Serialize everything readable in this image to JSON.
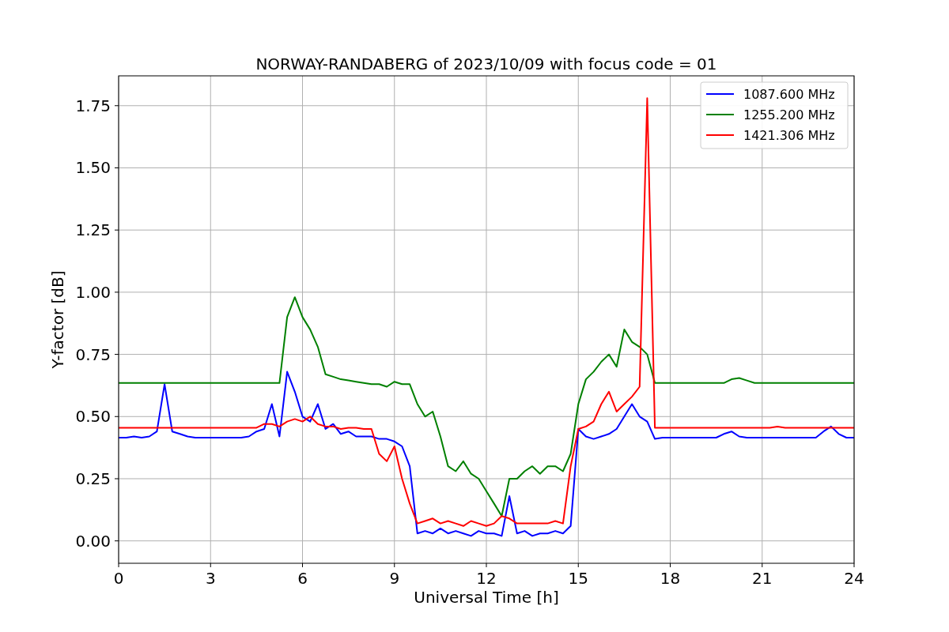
{
  "chart_data": {
    "type": "line",
    "title": "NORWAY-RANDABERG of 2023/10/09 with focus code = 01",
    "xlabel": "Universal Time [h]",
    "ylabel": "Y-factor [dB]",
    "x": [
      0,
      0.25,
      0.5,
      0.75,
      1,
      1.25,
      1.5,
      1.75,
      2,
      2.25,
      2.5,
      2.75,
      3,
      3.25,
      3.5,
      3.75,
      4,
      4.25,
      4.5,
      4.75,
      5,
      5.25,
      5.5,
      5.75,
      6,
      6.25,
      6.5,
      6.75,
      7,
      7.25,
      7.5,
      7.75,
      8,
      8.25,
      8.5,
      8.75,
      9,
      9.25,
      9.5,
      9.75,
      10,
      10.25,
      10.5,
      10.75,
      11,
      11.25,
      11.5,
      11.75,
      12,
      12.25,
      12.5,
      12.75,
      13,
      13.25,
      13.5,
      13.75,
      14,
      14.25,
      14.5,
      14.75,
      15,
      15.25,
      15.5,
      15.75,
      16,
      16.25,
      16.5,
      16.75,
      17,
      17.25,
      17.5,
      17.75,
      18,
      18.25,
      18.5,
      18.75,
      19,
      19.25,
      19.5,
      19.75,
      20,
      20.25,
      20.5,
      20.75,
      21,
      21.25,
      21.5,
      21.75,
      22,
      22.25,
      22.5,
      22.75,
      23,
      23.25,
      23.5,
      23.75,
      24
    ],
    "series": [
      {
        "name": "1087.600 MHz",
        "color": "#0000ff",
        "values": [
          0.415,
          0.415,
          0.42,
          0.415,
          0.42,
          0.44,
          0.63,
          0.44,
          0.43,
          0.42,
          0.415,
          0.415,
          0.415,
          0.415,
          0.415,
          0.415,
          0.415,
          0.42,
          0.44,
          0.45,
          0.55,
          0.42,
          0.68,
          0.6,
          0.5,
          0.48,
          0.55,
          0.45,
          0.47,
          0.43,
          0.44,
          0.42,
          0.42,
          0.42,
          0.41,
          0.41,
          0.4,
          0.38,
          0.3,
          0.03,
          0.04,
          0.03,
          0.05,
          0.03,
          0.04,
          0.03,
          0.02,
          0.04,
          0.03,
          0.03,
          0.02,
          0.18,
          0.03,
          0.04,
          0.02,
          0.03,
          0.03,
          0.04,
          0.03,
          0.06,
          0.45,
          0.42,
          0.41,
          0.42,
          0.43,
          0.45,
          0.5,
          0.55,
          0.5,
          0.48,
          0.41,
          0.415,
          0.415,
          0.415,
          0.415,
          0.415,
          0.415,
          0.415,
          0.415,
          0.43,
          0.44,
          0.42,
          0.415,
          0.415,
          0.415,
          0.415,
          0.415,
          0.415,
          0.415,
          0.415,
          0.415,
          0.415,
          0.44,
          0.46,
          0.43,
          0.415,
          0.415
        ]
      },
      {
        "name": "1255.200 MHz",
        "color": "#008000",
        "values": [
          0.635,
          0.635,
          0.635,
          0.635,
          0.635,
          0.635,
          0.635,
          0.635,
          0.635,
          0.635,
          0.635,
          0.635,
          0.635,
          0.635,
          0.635,
          0.635,
          0.635,
          0.635,
          0.635,
          0.635,
          0.635,
          0.635,
          0.9,
          0.98,
          0.9,
          0.85,
          0.78,
          0.67,
          0.66,
          0.65,
          0.645,
          0.64,
          0.635,
          0.63,
          0.63,
          0.62,
          0.64,
          0.63,
          0.63,
          0.55,
          0.5,
          0.52,
          0.42,
          0.3,
          0.28,
          0.32,
          0.27,
          0.25,
          0.2,
          0.15,
          0.1,
          0.25,
          0.25,
          0.28,
          0.3,
          0.27,
          0.3,
          0.3,
          0.28,
          0.35,
          0.55,
          0.65,
          0.68,
          0.72,
          0.75,
          0.7,
          0.85,
          0.8,
          0.78,
          0.75,
          0.635,
          0.635,
          0.635,
          0.635,
          0.635,
          0.635,
          0.635,
          0.635,
          0.635,
          0.635,
          0.65,
          0.655,
          0.645,
          0.635,
          0.635,
          0.635,
          0.635,
          0.635,
          0.635,
          0.635,
          0.635,
          0.635,
          0.635,
          0.635,
          0.635,
          0.635,
          0.635
        ]
      },
      {
        "name": "1421.306 MHz",
        "color": "#ff0000",
        "values": [
          0.455,
          0.455,
          0.455,
          0.455,
          0.455,
          0.455,
          0.455,
          0.455,
          0.455,
          0.455,
          0.455,
          0.455,
          0.455,
          0.455,
          0.455,
          0.455,
          0.455,
          0.455,
          0.455,
          0.47,
          0.47,
          0.46,
          0.48,
          0.49,
          0.48,
          0.5,
          0.47,
          0.46,
          0.46,
          0.45,
          0.455,
          0.455,
          0.45,
          0.45,
          0.35,
          0.32,
          0.38,
          0.25,
          0.15,
          0.07,
          0.08,
          0.09,
          0.07,
          0.08,
          0.07,
          0.06,
          0.08,
          0.07,
          0.06,
          0.07,
          0.1,
          0.09,
          0.07,
          0.07,
          0.07,
          0.07,
          0.07,
          0.08,
          0.07,
          0.3,
          0.45,
          0.46,
          0.48,
          0.55,
          0.6,
          0.52,
          0.55,
          0.58,
          0.62,
          1.78,
          0.455,
          0.455,
          0.455,
          0.455,
          0.455,
          0.455,
          0.455,
          0.455,
          0.455,
          0.455,
          0.455,
          0.455,
          0.455,
          0.455,
          0.455,
          0.455,
          0.46,
          0.455,
          0.455,
          0.455,
          0.455,
          0.455,
          0.455,
          0.455,
          0.455,
          0.455,
          0.455
        ]
      }
    ],
    "grid": true,
    "legend": true,
    "xlim": [
      0,
      24
    ],
    "ylim": [
      -0.09,
      1.87
    ],
    "xticks": [
      0,
      3,
      6,
      9,
      12,
      15,
      18,
      21,
      24
    ],
    "yticks": [
      {
        "value": 0,
        "label": "0.00"
      },
      {
        "value": 0.25,
        "label": "0.25"
      },
      {
        "value": 0.5,
        "label": "0.50"
      },
      {
        "value": 0.75,
        "label": "0.75"
      },
      {
        "value": 1,
        "label": "1.00"
      },
      {
        "value": 1.25,
        "label": "1.25"
      },
      {
        "value": 1.5,
        "label": "1.50"
      },
      {
        "value": 1.75,
        "label": "1.75"
      }
    ]
  }
}
